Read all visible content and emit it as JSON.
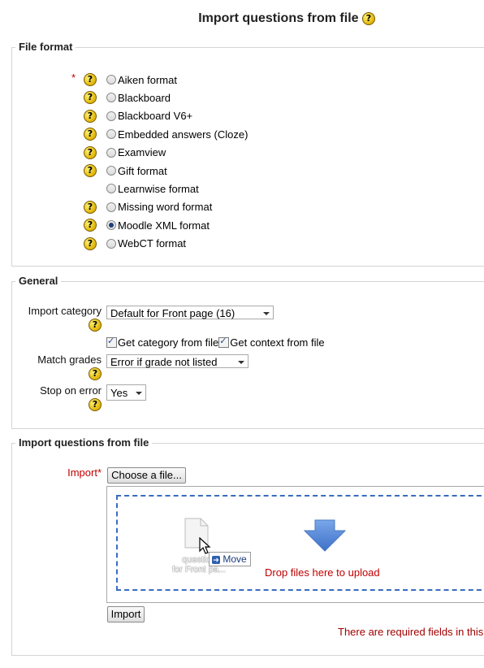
{
  "page": {
    "title": "Import questions from file"
  },
  "file_format": {
    "legend": "File format",
    "required_mark": "*",
    "options": [
      {
        "label": "Aiken format",
        "help": true,
        "selected": false
      },
      {
        "label": "Blackboard",
        "help": true,
        "selected": false
      },
      {
        "label": "Blackboard V6+",
        "help": true,
        "selected": false
      },
      {
        "label": "Embedded answers (Cloze)",
        "help": true,
        "selected": false
      },
      {
        "label": "Examview",
        "help": true,
        "selected": false
      },
      {
        "label": "Gift format",
        "help": true,
        "selected": false
      },
      {
        "label": "Learnwise format",
        "help": false,
        "selected": false
      },
      {
        "label": "Missing word format",
        "help": true,
        "selected": false
      },
      {
        "label": "Moodle XML format",
        "help": true,
        "selected": true
      },
      {
        "label": "WebCT format",
        "help": true,
        "selected": false
      }
    ]
  },
  "general": {
    "legend": "General",
    "import_category_label": "Import category",
    "import_category_value": "Default for Front page (16)",
    "get_category_label": "Get category from file",
    "get_context_label": "Get context from file",
    "match_grades_label": "Match grades",
    "match_grades_value": "Error if grade not listed",
    "stop_on_error_label": "Stop on error",
    "stop_on_error_value": "Yes"
  },
  "import_file": {
    "legend": "Import questions from file",
    "import_label": "Import",
    "required_mark": "*",
    "choose_button": "Choose a file...",
    "dragged_file_name_line1": "question",
    "dragged_file_name_line2": "for Front pa...",
    "move_tooltip": "Move",
    "drop_text": "Drop files here to upload",
    "import_button": "Import",
    "required_notice": "There are required fields in this"
  },
  "help_glyph": "?",
  "colors": {
    "required": "#c00000",
    "arrow_blue": "#4a7fd0",
    "dashed_border": "#3a6cc0"
  }
}
